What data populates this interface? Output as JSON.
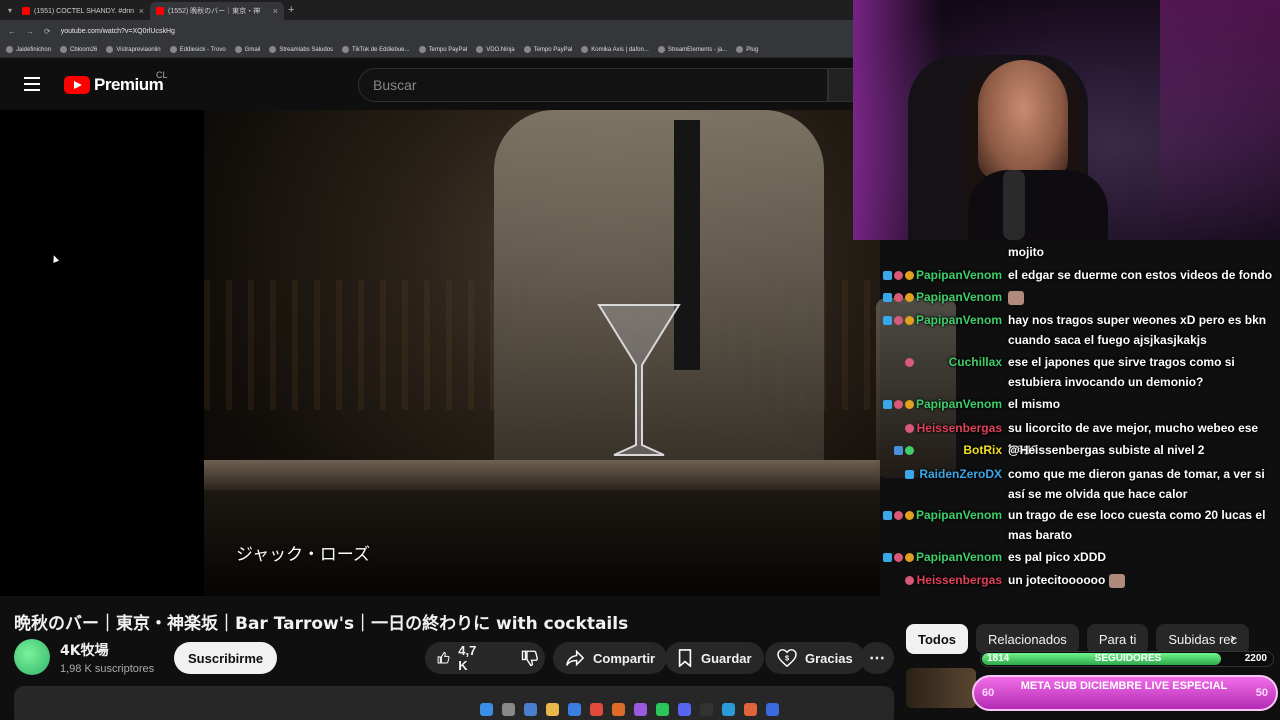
{
  "browser": {
    "tabs": [
      {
        "label": "(1551) CÓCTEL SHANDY. #drin"
      },
      {
        "label": "(1552) 晩秋のバー｜東京・神"
      }
    ],
    "url": "youtube.com/watch?v=XQ0rlUcskHg",
    "bookmarks": [
      "Jaidefinichon",
      "Cbloom26",
      "Vistrapreviaonlin",
      "Eddiesick - Trovo",
      "Gmail",
      "Streamlabs Saludos",
      "TikTok de Eddiebue...",
      "Tempo PayPal",
      "VDO.Ninja",
      "Tempo PayPal",
      "Komika Axis | dafon...",
      "StreamElements - ja...",
      "Plug"
    ]
  },
  "header": {
    "logo_text": "Premium",
    "country": "CL",
    "search_placeholder": "Buscar"
  },
  "video": {
    "subtitle": "ジャック・ローズ",
    "title": "晩秋のバー｜東京・神楽坂｜Bar Tarrow's｜一日の終わりに with cocktails"
  },
  "channel": {
    "name": "4K牧場",
    "subscribers": "1,98 K suscriptores",
    "subscribe_label": "Suscribirme"
  },
  "actions": {
    "likes": "4,7 K",
    "share": "Compartir",
    "save": "Guardar",
    "thanks": "Gracias"
  },
  "chat": [
    {
      "user": "",
      "text": "mojito",
      "color": "#ffffff"
    },
    {
      "user": "PapipanVenom",
      "text": "el edgar se duerme con estos videos de fondo",
      "color": "#3ecf6a"
    },
    {
      "user": "PapipanVenom",
      "text": "",
      "color": "#3ecf6a"
    },
    {
      "user": "PapipanVenom",
      "text": "hay nos tragos super weones xD pero es bkn cuando saca el fuego ajsjkasjkakjs",
      "color": "#3ecf6a"
    },
    {
      "user": "Cuchillax",
      "text": "ese el japones que sirve tragos como si estubiera invocando un demonio?",
      "color": "#3ecf6a"
    },
    {
      "user": "PapipanVenom",
      "text": "el mismo",
      "color": "#3ecf6a"
    },
    {
      "user": "Heissenbergas",
      "text": "su licorcito de ave mejor, mucho webeo ese trago",
      "color": "#e0405a"
    },
    {
      "user": "BotRix",
      "text": "@Heissenbergas subiste al nivel 2",
      "color": "#f0e020"
    },
    {
      "user": "RaidenZeroDX",
      "text": "como que me dieron ganas de tomar, a ver si así se me olvida que hace calor",
      "color": "#3aa7e8"
    },
    {
      "user": "PapipanVenom",
      "text": "un trago de ese loco cuesta como 20 lucas el mas barato",
      "color": "#3ecf6a"
    },
    {
      "user": "PapipanVenom",
      "text": "es pal pico xDDD",
      "color": "#3ecf6a"
    },
    {
      "user": "Heissenbergas",
      "text": "un jotecitoooooo",
      "color": "#e0405a"
    }
  ],
  "related_tabs": [
    "Todos",
    "Relacionados",
    "Para ti",
    "Subidas rec"
  ],
  "goals": {
    "followers": {
      "current": "1814",
      "label": "SEGUIDORES",
      "target": "2200",
      "progress": 0.82
    },
    "subs": {
      "current": "60",
      "label": "META SUB DICIEMBRE LIVE ESPECIAL",
      "target": "50"
    }
  },
  "colors": {
    "yt_red": "#ff0000",
    "accent_green": "#3ecf6a",
    "goal_pink": "#d64ad6"
  }
}
